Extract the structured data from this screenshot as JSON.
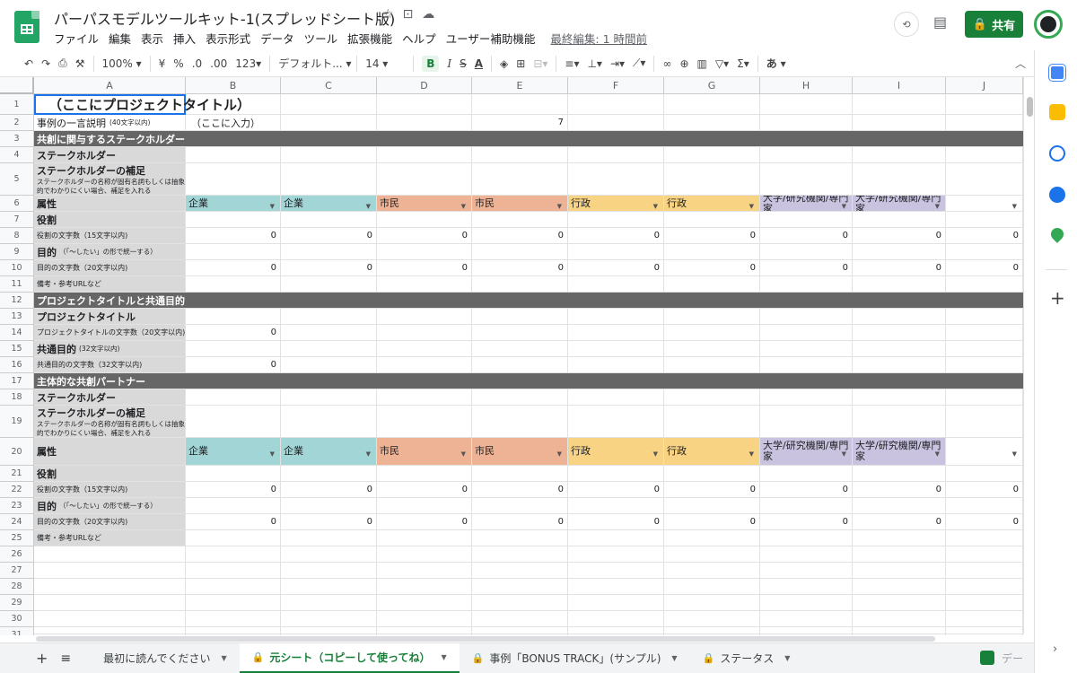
{
  "header": {
    "doc_title": "パーパスモデルツールキット-1(スプレッドシート版)",
    "menus": [
      "ファイル",
      "編集",
      "表示",
      "挿入",
      "表示形式",
      "データ",
      "ツール",
      "拡張機能",
      "ヘルプ",
      "ユーザー補助機能"
    ],
    "last_edit": "最終編集: 1 時間前",
    "share_label": "共有",
    "title_icons": [
      "star-icon",
      "folder-move-icon",
      "cloud-saved-icon"
    ]
  },
  "toolbar": {
    "zoom": "100%",
    "currency": "¥",
    "percent": "%",
    "dec_less": ".0",
    "dec_more": ".00",
    "format_more": "123",
    "font": "デフォルト...",
    "font_size": "14",
    "bold": "B",
    "italic": "I",
    "strike": "S",
    "text_color": "A",
    "input_tool": "あ"
  },
  "columns": [
    "A",
    "B",
    "C",
    "D",
    "E",
    "F",
    "G",
    "H",
    "I",
    "J"
  ],
  "row_numbers": [
    "1",
    "2",
    "3",
    "4",
    "5",
    "6",
    "7",
    "8",
    "9",
    "10",
    "11",
    "12",
    "13",
    "14",
    "15",
    "16",
    "17",
    "18",
    "19",
    "20",
    "21",
    "22",
    "23",
    "24",
    "25",
    "26",
    "27",
    "28",
    "29",
    "30",
    "31"
  ],
  "sheet": {
    "title": "（ここにプロジェクトタイトル）",
    "r2_label": "事例の一言説明",
    "r2_note": "(40文字以内)",
    "r2_input": "（ここに入力）",
    "r2_count": "7",
    "sec1": "共創に関与するステークホルダー",
    "stakeholder": "ステークホルダー",
    "stakeholder_sup": "ステークホルダーの補足",
    "stakeholder_sup_note": "ステークホルダーの名称が固有名詞もしくは抽象的でわかりにくい場合、補足を入れる",
    "attr": "属性",
    "attr_values": [
      "企業",
      "企業",
      "市民",
      "市民",
      "行政",
      "行政",
      "大学/研究機関/専門家",
      "大学/研究機関/専門家",
      ""
    ],
    "role": "役割",
    "role_count_label": "役割の文字数（15文字以内)",
    "purpose": "目的",
    "purpose_note": "（「〜したい」の形で統一する）",
    "purpose_count_label": "目的の文字数（20文字以内)",
    "notes_label": "備考・参考URLなど",
    "zero": "0",
    "sec2": "プロジェクトタイトルと共通目的",
    "project_title": "プロジェクトタイトル",
    "project_title_count": "プロジェクトタイトルの文字数（20文字以内)",
    "common_purpose": "共通目的",
    "common_purpose_note": "(32文字以内)",
    "common_purpose_count": "共通目的の文字数（32文字以内)",
    "sec3": "主体的な共創パートナー"
  },
  "colors": {
    "corp": "#a2d5d6",
    "citizen": "#eeb294",
    "gov": "#f8d383",
    "academia": "#c9c3e0",
    "section": "#666666",
    "label_bg": "#d9d9d9",
    "share_green": "#188038"
  },
  "tabs": [
    {
      "label": "最初に読んでください",
      "lock": false,
      "active": false
    },
    {
      "label": "元シート（コピーして使ってね）",
      "lock": true,
      "active": true
    },
    {
      "label": "事例「BONUS TRACK」(サンプル)",
      "lock": true,
      "active": false
    },
    {
      "label": "ステータス",
      "lock": true,
      "active": false
    }
  ],
  "explore_label": "デー"
}
